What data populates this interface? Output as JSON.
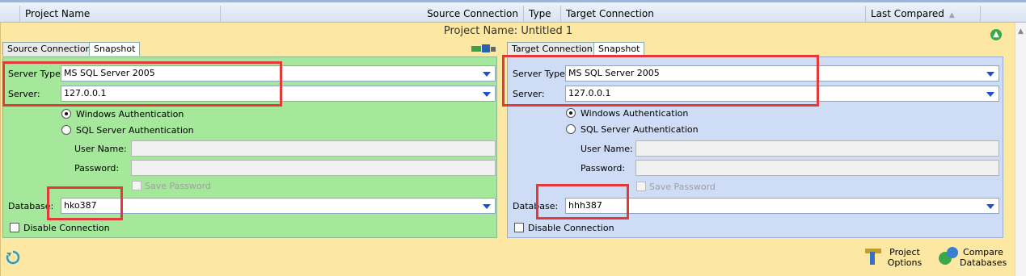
{
  "header": {
    "project_name": "Project Name",
    "source_connection": "Source Connection",
    "type": "Type",
    "target_connection": "Target Connection",
    "last_compared": "Last Compared"
  },
  "project": {
    "title": "Project Name:  Untitled 1"
  },
  "source": {
    "tab_connection": "Source Connection",
    "tab_snapshot": "Snapshot",
    "server_type_label": "Server Type:",
    "server_type_value": "MS SQL Server 2005",
    "server_label": "Server:",
    "server_value": "127.0.0.1",
    "auth_windows": "Windows Authentication",
    "auth_sql": "SQL Server Authentication",
    "username_label": "User Name:",
    "password_label": "Password:",
    "save_password": "Save Password",
    "database_label": "Database:",
    "database_value": "hko387",
    "disable_connection": "Disable Connection"
  },
  "target": {
    "tab_connection": "Target Connection",
    "tab_snapshot": "Snapshot",
    "server_type_label": "Server Type:",
    "server_type_value": "MS SQL Server 2005",
    "server_label": "Server:",
    "server_value": "127.0.0.1",
    "auth_windows": "Windows Authentication",
    "auth_sql": "SQL Server Authentication",
    "username_label": "User Name:",
    "password_label": "Password:",
    "save_password": "Save Password",
    "database_label": "Database:",
    "database_value": "hhh387",
    "disable_connection": "Disable Connection"
  },
  "footer": {
    "project_options_line1": "Project",
    "project_options_line2": "Options",
    "compare_line1": "Compare",
    "compare_line2": "Databases"
  },
  "icons": [
    "refresh-icon",
    "collapse-icon",
    "copy-connection-icon",
    "project-options-icon",
    "compare-databases-icon",
    "dropdown-arrow-icon"
  ],
  "colors": {
    "source_panel": "#a5e79b",
    "target_panel": "#cfdcf6",
    "project_bg": "#fce7a3",
    "highlight": "#e23a3a",
    "dropdown_arrow": "#1d4fd4"
  }
}
